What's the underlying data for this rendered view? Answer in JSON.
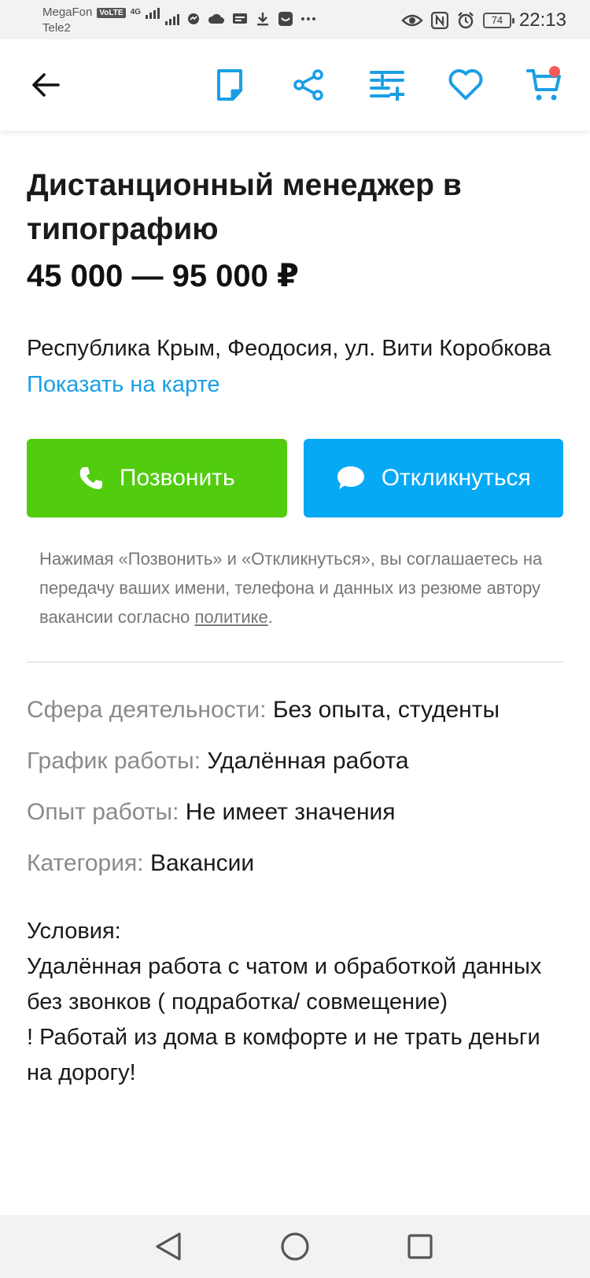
{
  "status_bar": {
    "carrier1": "MegaFon",
    "volte": "VoLTE",
    "net": "4G",
    "carrier2": "Tele2",
    "battery": "74",
    "time": "22:13"
  },
  "header": {
    "icons": [
      "back-icon",
      "note-icon",
      "share-icon",
      "add-to-list-icon",
      "heart-icon",
      "cart-icon"
    ],
    "accent_color": "#1a9fe6",
    "cart_badge_color": "#f25a5a"
  },
  "vacancy": {
    "title": "Дистанционный менеджер в типографию",
    "salary": "45 000 — 95 000 ₽",
    "address": "Республика Крым, Феодосия, ул. Вити Коробкова",
    "map_link": "Показать на карте"
  },
  "actions": {
    "call_label": "Позвонить",
    "call_color": "#52cc0f",
    "reply_label": "Откликнуться",
    "reply_color": "#07a9f5"
  },
  "consent": {
    "text": "Нажимая «Позвонить» и «Откликнуться», вы соглашаетесь на передачу ваших имени, телефона и данных из резюме автору вакансии согласно ",
    "policy_link": "политике",
    "tail": "."
  },
  "params": [
    {
      "key": "Сфера деятельности:",
      "value": "Без опыта, студенты"
    },
    {
      "key": "График работы:",
      "value": "Удалённая работа"
    },
    {
      "key": "Опыт работы:",
      "value": "Не имеет значения"
    },
    {
      "key": "Категория:",
      "value": "Вакансии"
    }
  ],
  "description": {
    "line1": "Условия:",
    "line2": "Удалённая работа с чатом и обработкой данных без звонков ( подработка/ совмещение)",
    "line3": "! Работай из дома в комфорте и не трать деньги на дорогу!"
  }
}
